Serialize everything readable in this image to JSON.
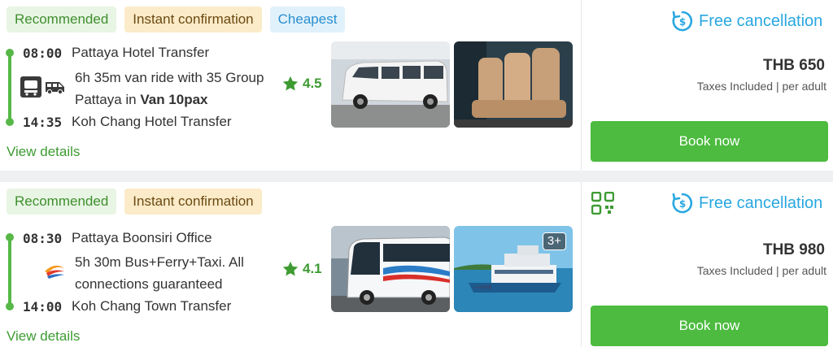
{
  "listings": [
    {
      "badges": [
        "Recommended",
        "Instant confirmation",
        "Cheapest"
      ],
      "depart_time": "08:00",
      "depart_place": "Pattaya Hotel Transfer",
      "desc_text": "6h 35m van ride with 35 Group Pattaya in",
      "desc_vehicle": "Van 10pax",
      "rating": "4.5",
      "arrive_time": "14:35",
      "arrive_place": "Koh Chang Hotel Transfer",
      "details_link": "View details",
      "free_cancellation": "Free cancellation",
      "price": "THB 650",
      "taxes": "Taxes Included | per adult",
      "book_label": "Book now",
      "photo_icons": [
        "van-photo",
        "van-seats-photo"
      ]
    },
    {
      "badges": [
        "Recommended",
        "Instant confirmation"
      ],
      "depart_time": "08:30",
      "depart_place": "Pattaya Boonsiri Office",
      "desc_text": "5h 30m Bus+Ferry+Taxi. All connections guaranteed",
      "rating": "4.1",
      "arrive_time": "14:00",
      "arrive_place": "Koh Chang Town Transfer",
      "details_link": "View details",
      "more_photos": "3+",
      "free_cancellation": "Free cancellation",
      "price": "THB 980",
      "taxes": "Taxes Included | per adult",
      "book_label": "Book now",
      "photo_icons": [
        "bus-photo",
        "ferry-photo"
      ]
    }
  ],
  "colors": {
    "accent_green": "#4cbb3f",
    "link_green": "#3d9b32",
    "cancel_blue": "#28a7e0",
    "badge_recommended_bg": "#e8f5e4",
    "badge_instant_bg": "#fbebc8",
    "badge_cheapest_bg": "#e1f1fb"
  }
}
